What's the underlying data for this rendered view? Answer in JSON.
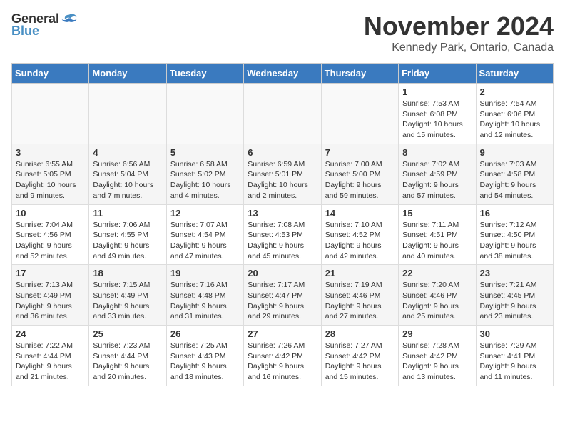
{
  "logo": {
    "general": "General",
    "blue": "Blue"
  },
  "header": {
    "month": "November 2024",
    "location": "Kennedy Park, Ontario, Canada"
  },
  "weekdays": [
    "Sunday",
    "Monday",
    "Tuesday",
    "Wednesday",
    "Thursday",
    "Friday",
    "Saturday"
  ],
  "weeks": [
    [
      {
        "day": "",
        "info": ""
      },
      {
        "day": "",
        "info": ""
      },
      {
        "day": "",
        "info": ""
      },
      {
        "day": "",
        "info": ""
      },
      {
        "day": "",
        "info": ""
      },
      {
        "day": "1",
        "info": "Sunrise: 7:53 AM\nSunset: 6:08 PM\nDaylight: 10 hours and 15 minutes."
      },
      {
        "day": "2",
        "info": "Sunrise: 7:54 AM\nSunset: 6:06 PM\nDaylight: 10 hours and 12 minutes."
      }
    ],
    [
      {
        "day": "3",
        "info": "Sunrise: 6:55 AM\nSunset: 5:05 PM\nDaylight: 10 hours and 9 minutes."
      },
      {
        "day": "4",
        "info": "Sunrise: 6:56 AM\nSunset: 5:04 PM\nDaylight: 10 hours and 7 minutes."
      },
      {
        "day": "5",
        "info": "Sunrise: 6:58 AM\nSunset: 5:02 PM\nDaylight: 10 hours and 4 minutes."
      },
      {
        "day": "6",
        "info": "Sunrise: 6:59 AM\nSunset: 5:01 PM\nDaylight: 10 hours and 2 minutes."
      },
      {
        "day": "7",
        "info": "Sunrise: 7:00 AM\nSunset: 5:00 PM\nDaylight: 9 hours and 59 minutes."
      },
      {
        "day": "8",
        "info": "Sunrise: 7:02 AM\nSunset: 4:59 PM\nDaylight: 9 hours and 57 minutes."
      },
      {
        "day": "9",
        "info": "Sunrise: 7:03 AM\nSunset: 4:58 PM\nDaylight: 9 hours and 54 minutes."
      }
    ],
    [
      {
        "day": "10",
        "info": "Sunrise: 7:04 AM\nSunset: 4:56 PM\nDaylight: 9 hours and 52 minutes."
      },
      {
        "day": "11",
        "info": "Sunrise: 7:06 AM\nSunset: 4:55 PM\nDaylight: 9 hours and 49 minutes."
      },
      {
        "day": "12",
        "info": "Sunrise: 7:07 AM\nSunset: 4:54 PM\nDaylight: 9 hours and 47 minutes."
      },
      {
        "day": "13",
        "info": "Sunrise: 7:08 AM\nSunset: 4:53 PM\nDaylight: 9 hours and 45 minutes."
      },
      {
        "day": "14",
        "info": "Sunrise: 7:10 AM\nSunset: 4:52 PM\nDaylight: 9 hours and 42 minutes."
      },
      {
        "day": "15",
        "info": "Sunrise: 7:11 AM\nSunset: 4:51 PM\nDaylight: 9 hours and 40 minutes."
      },
      {
        "day": "16",
        "info": "Sunrise: 7:12 AM\nSunset: 4:50 PM\nDaylight: 9 hours and 38 minutes."
      }
    ],
    [
      {
        "day": "17",
        "info": "Sunrise: 7:13 AM\nSunset: 4:49 PM\nDaylight: 9 hours and 36 minutes."
      },
      {
        "day": "18",
        "info": "Sunrise: 7:15 AM\nSunset: 4:49 PM\nDaylight: 9 hours and 33 minutes."
      },
      {
        "day": "19",
        "info": "Sunrise: 7:16 AM\nSunset: 4:48 PM\nDaylight: 9 hours and 31 minutes."
      },
      {
        "day": "20",
        "info": "Sunrise: 7:17 AM\nSunset: 4:47 PM\nDaylight: 9 hours and 29 minutes."
      },
      {
        "day": "21",
        "info": "Sunrise: 7:19 AM\nSunset: 4:46 PM\nDaylight: 9 hours and 27 minutes."
      },
      {
        "day": "22",
        "info": "Sunrise: 7:20 AM\nSunset: 4:46 PM\nDaylight: 9 hours and 25 minutes."
      },
      {
        "day": "23",
        "info": "Sunrise: 7:21 AM\nSunset: 4:45 PM\nDaylight: 9 hours and 23 minutes."
      }
    ],
    [
      {
        "day": "24",
        "info": "Sunrise: 7:22 AM\nSunset: 4:44 PM\nDaylight: 9 hours and 21 minutes."
      },
      {
        "day": "25",
        "info": "Sunrise: 7:23 AM\nSunset: 4:44 PM\nDaylight: 9 hours and 20 minutes."
      },
      {
        "day": "26",
        "info": "Sunrise: 7:25 AM\nSunset: 4:43 PM\nDaylight: 9 hours and 18 minutes."
      },
      {
        "day": "27",
        "info": "Sunrise: 7:26 AM\nSunset: 4:42 PM\nDaylight: 9 hours and 16 minutes."
      },
      {
        "day": "28",
        "info": "Sunrise: 7:27 AM\nSunset: 4:42 PM\nDaylight: 9 hours and 15 minutes."
      },
      {
        "day": "29",
        "info": "Sunrise: 7:28 AM\nSunset: 4:42 PM\nDaylight: 9 hours and 13 minutes."
      },
      {
        "day": "30",
        "info": "Sunrise: 7:29 AM\nSunset: 4:41 PM\nDaylight: 9 hours and 11 minutes."
      }
    ]
  ]
}
